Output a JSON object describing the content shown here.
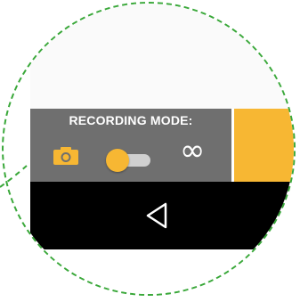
{
  "recording_mode": {
    "title": "RECORDING MODE:",
    "photo_icon": "camera-icon",
    "toggle_state": "photo",
    "infinite_icon": "infinity-icon",
    "infinite_glyph": "∞"
  },
  "nav_bar": {
    "back_icon": "back-triangle-icon"
  },
  "colors": {
    "accent": "#f7b733",
    "panel": "#6f6f6f",
    "nav": "#000000",
    "callout": "#3aa83a"
  }
}
